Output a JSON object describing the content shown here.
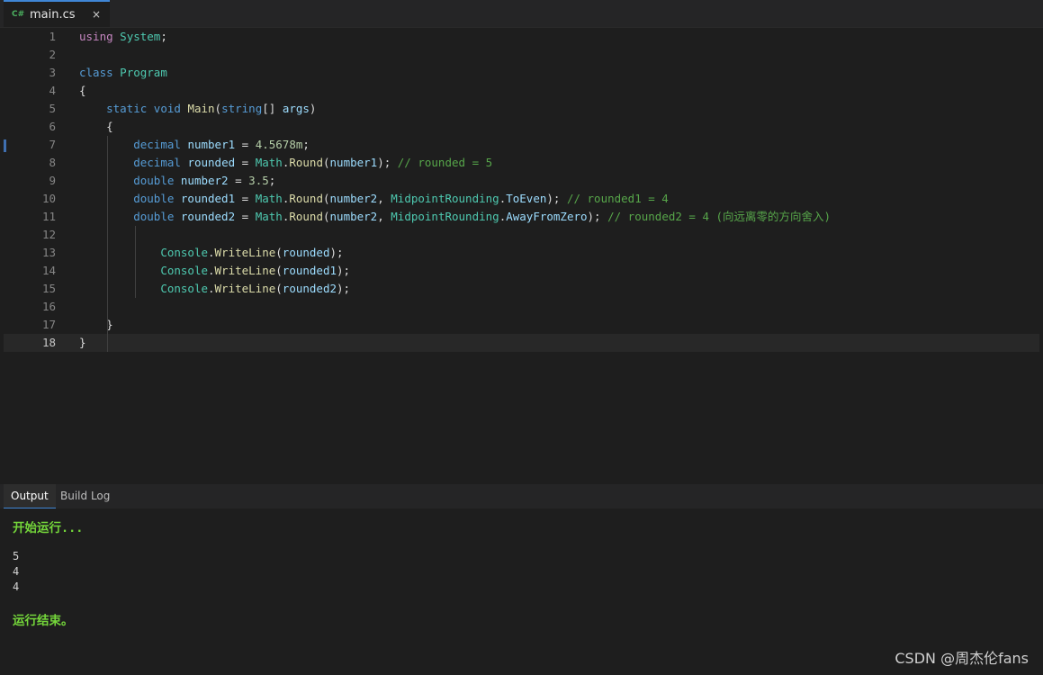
{
  "tab": {
    "icon": "C#",
    "filename": "main.cs",
    "close": "×"
  },
  "code_lines": [
    {
      "n": "1",
      "tokens": [
        [
          "kw",
          "using"
        ],
        [
          "pl",
          " "
        ],
        [
          "ty",
          "System"
        ],
        [
          "pl",
          ";"
        ]
      ]
    },
    {
      "n": "2",
      "tokens": []
    },
    {
      "n": "3",
      "tokens": [
        [
          "kb",
          "class"
        ],
        [
          "pl",
          " "
        ],
        [
          "ty",
          "Program"
        ]
      ]
    },
    {
      "n": "4",
      "tokens": [
        [
          "pl",
          "{"
        ]
      ]
    },
    {
      "n": "5",
      "tokens": [
        [
          "pl",
          "    "
        ],
        [
          "kb",
          "static"
        ],
        [
          "pl",
          " "
        ],
        [
          "kb",
          "void"
        ],
        [
          "pl",
          " "
        ],
        [
          "fn",
          "Main"
        ],
        [
          "pl",
          "("
        ],
        [
          "kb",
          "string"
        ],
        [
          "pl",
          "[] "
        ],
        [
          "vr",
          "args"
        ],
        [
          "pl",
          ")"
        ]
      ]
    },
    {
      "n": "6",
      "tokens": [
        [
          "pl",
          "    {"
        ]
      ]
    },
    {
      "n": "7",
      "tokens": [
        [
          "pl",
          "        "
        ],
        [
          "kb",
          "decimal"
        ],
        [
          "pl",
          " "
        ],
        [
          "vr",
          "number1"
        ],
        [
          "pl",
          " = "
        ],
        [
          "nm",
          "4.5678m"
        ],
        [
          "pl",
          ";"
        ]
      ]
    },
    {
      "n": "8",
      "tokens": [
        [
          "pl",
          "        "
        ],
        [
          "kb",
          "decimal"
        ],
        [
          "pl",
          " "
        ],
        [
          "vr",
          "rounded"
        ],
        [
          "pl",
          " = "
        ],
        [
          "ty",
          "Math"
        ],
        [
          "pl",
          "."
        ],
        [
          "fn",
          "Round"
        ],
        [
          "pl",
          "("
        ],
        [
          "vr",
          "number1"
        ],
        [
          "pl",
          "); "
        ],
        [
          "cm",
          "// rounded = 5"
        ]
      ]
    },
    {
      "n": "9",
      "tokens": [
        [
          "pl",
          "        "
        ],
        [
          "kb",
          "double"
        ],
        [
          "pl",
          " "
        ],
        [
          "vr",
          "number2"
        ],
        [
          "pl",
          " = "
        ],
        [
          "nm",
          "3.5"
        ],
        [
          "pl",
          ";"
        ]
      ]
    },
    {
      "n": "10",
      "tokens": [
        [
          "pl",
          "        "
        ],
        [
          "kb",
          "double"
        ],
        [
          "pl",
          " "
        ],
        [
          "vr",
          "rounded1"
        ],
        [
          "pl",
          " = "
        ],
        [
          "ty",
          "Math"
        ],
        [
          "pl",
          "."
        ],
        [
          "fn",
          "Round"
        ],
        [
          "pl",
          "("
        ],
        [
          "vr",
          "number2"
        ],
        [
          "pl",
          ", "
        ],
        [
          "ty",
          "MidpointRounding"
        ],
        [
          "pl",
          "."
        ],
        [
          "vr",
          "ToEven"
        ],
        [
          "pl",
          "); "
        ],
        [
          "cm",
          "// rounded1 = 4"
        ]
      ]
    },
    {
      "n": "11",
      "tokens": [
        [
          "pl",
          "        "
        ],
        [
          "kb",
          "double"
        ],
        [
          "pl",
          " "
        ],
        [
          "vr",
          "rounded2"
        ],
        [
          "pl",
          " = "
        ],
        [
          "ty",
          "Math"
        ],
        [
          "pl",
          "."
        ],
        [
          "fn",
          "Round"
        ],
        [
          "pl",
          "("
        ],
        [
          "vr",
          "number2"
        ],
        [
          "pl",
          ", "
        ],
        [
          "ty",
          "MidpointRounding"
        ],
        [
          "pl",
          "."
        ],
        [
          "vr",
          "AwayFromZero"
        ],
        [
          "pl",
          "); "
        ],
        [
          "cm",
          "// rounded2 = 4 (向远离零的方向舍入)"
        ]
      ]
    },
    {
      "n": "12",
      "tokens": []
    },
    {
      "n": "13",
      "tokens": [
        [
          "pl",
          "            "
        ],
        [
          "ty",
          "Console"
        ],
        [
          "pl",
          "."
        ],
        [
          "fn",
          "WriteLine"
        ],
        [
          "pl",
          "("
        ],
        [
          "vr",
          "rounded"
        ],
        [
          "pl",
          ");"
        ]
      ]
    },
    {
      "n": "14",
      "tokens": [
        [
          "pl",
          "            "
        ],
        [
          "ty",
          "Console"
        ],
        [
          "pl",
          "."
        ],
        [
          "fn",
          "WriteLine"
        ],
        [
          "pl",
          "("
        ],
        [
          "vr",
          "rounded1"
        ],
        [
          "pl",
          ");"
        ]
      ]
    },
    {
      "n": "15",
      "tokens": [
        [
          "pl",
          "            "
        ],
        [
          "ty",
          "Console"
        ],
        [
          "pl",
          "."
        ],
        [
          "fn",
          "WriteLine"
        ],
        [
          "pl",
          "("
        ],
        [
          "vr",
          "rounded2"
        ],
        [
          "pl",
          ");"
        ]
      ]
    },
    {
      "n": "16",
      "tokens": []
    },
    {
      "n": "17",
      "tokens": [
        [
          "pl",
          "    }"
        ]
      ]
    },
    {
      "n": "18",
      "tokens": [
        [
          "pl",
          "}"
        ]
      ]
    }
  ],
  "current_line": "18",
  "panel": {
    "tabs": [
      {
        "label": "Output",
        "active": true
      },
      {
        "label": "Build Log",
        "active": false
      }
    ],
    "output": {
      "start": "开始运行...",
      "results": [
        "5",
        "4",
        "4"
      ],
      "end": "运行结束。"
    }
  },
  "watermark": "CSDN @周杰伦fans"
}
